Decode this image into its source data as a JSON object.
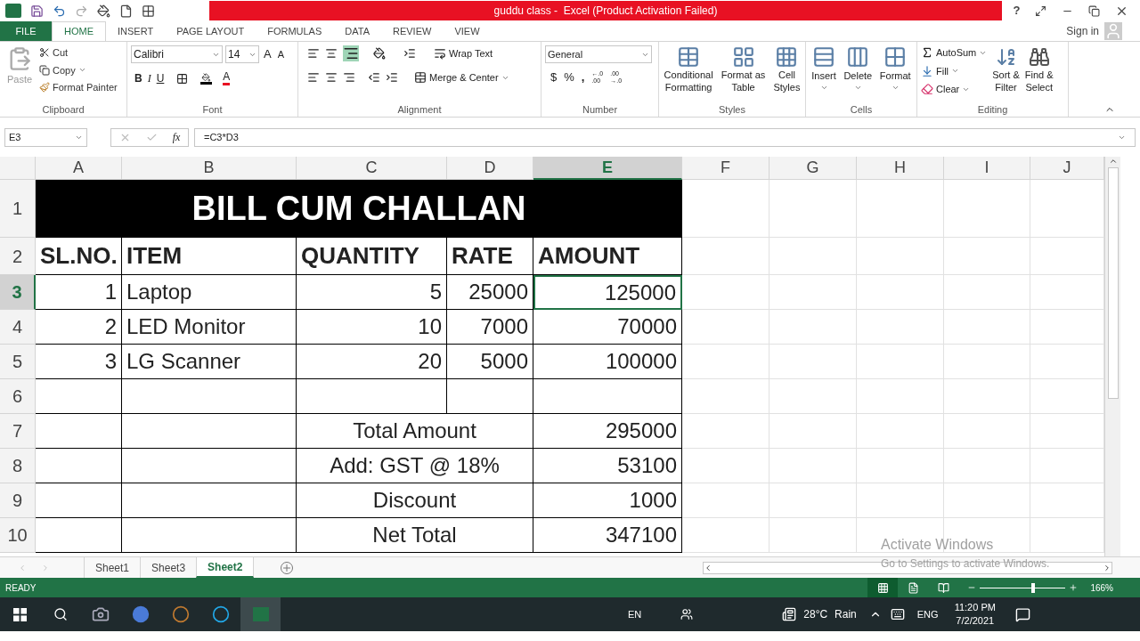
{
  "window": {
    "title": "guddu class -  Excel (Product Activation Failed)",
    "help": "?"
  },
  "ribbon_tabs": [
    {
      "label": "FILE",
      "kind": "file",
      "selected": false
    },
    {
      "label": "HOME",
      "kind": "tab",
      "selected": true
    },
    {
      "label": "INSERT",
      "kind": "tab",
      "selected": false
    },
    {
      "label": "PAGE LAYOUT",
      "kind": "tab",
      "selected": false
    },
    {
      "label": "FORMULAS",
      "kind": "tab",
      "selected": false
    },
    {
      "label": "DATA",
      "kind": "tab",
      "selected": false
    },
    {
      "label": "REVIEW",
      "kind": "tab",
      "selected": false
    },
    {
      "label": "VIEW",
      "kind": "tab",
      "selected": false
    }
  ],
  "sign_in": "Sign in",
  "clipboard": {
    "label": "Clipboard",
    "paste": "Paste",
    "cut": "Cut",
    "copy": "Copy",
    "format_painter": "Format Painter"
  },
  "font": {
    "label": "Font",
    "name": "Calibri",
    "size": "14",
    "grow": "A",
    "shrink": "A",
    "bold": "B",
    "italic": "I",
    "underline": "U",
    "color_button": "A"
  },
  "alignment": {
    "label": "Alignment",
    "wrap": "Wrap Text",
    "merge": "Merge & Center"
  },
  "number": {
    "label": "Number",
    "format": "General",
    "currency": "$",
    "percent": "%",
    "comma": ",",
    "increase_decimal": [
      "←.0",
      ".00"
    ],
    "decrease_decimal": [
      ".00",
      "→.0"
    ]
  },
  "styles": {
    "label": "Styles",
    "items": [
      {
        "lines": [
          "Conditional",
          "Formatting"
        ]
      },
      {
        "lines": [
          "Format as",
          "Table"
        ]
      },
      {
        "lines": [
          "Cell",
          "Styles"
        ]
      }
    ]
  },
  "cells": {
    "label": "Cells",
    "items": [
      "Insert",
      "Delete",
      "Format"
    ]
  },
  "editing": {
    "label": "Editing",
    "autosum": "AutoSum",
    "fill": "Fill",
    "clear": "Clear",
    "sort": [
      "Sort &",
      "Filter"
    ],
    "find": [
      "Find &",
      "Select"
    ]
  },
  "formula_bar": {
    "name_box": "E3",
    "fx": "fx",
    "formula": "=C3*D3"
  },
  "columns": [
    {
      "label": "A",
      "selected": false
    },
    {
      "label": "B",
      "selected": false
    },
    {
      "label": "C",
      "selected": false
    },
    {
      "label": "D",
      "selected": false
    },
    {
      "label": "E",
      "selected": true
    },
    {
      "label": "F",
      "selected": false
    },
    {
      "label": "G",
      "selected": false
    },
    {
      "label": "H",
      "selected": false
    },
    {
      "label": "I",
      "selected": false
    },
    {
      "label": "J",
      "selected": false
    }
  ],
  "rows": [
    {
      "label": "1",
      "selected": false
    },
    {
      "label": "2",
      "selected": false
    },
    {
      "label": "3",
      "selected": true
    },
    {
      "label": "4",
      "selected": false
    },
    {
      "label": "5",
      "selected": false
    },
    {
      "label": "6",
      "selected": false
    },
    {
      "label": "7",
      "selected": false
    },
    {
      "label": "8",
      "selected": false
    },
    {
      "label": "9",
      "selected": false
    },
    {
      "label": "10",
      "selected": false
    }
  ],
  "sheet": {
    "title": "BILL CUM CHALLAN",
    "headers": [
      "SL.NO.",
      "ITEM",
      "QUANTITY",
      "RATE",
      "AMOUNT"
    ],
    "items": [
      {
        "cells": [
          {
            "text": "1",
            "selected": false
          },
          {
            "text": "Laptop",
            "selected": false
          },
          {
            "text": "5",
            "selected": false
          },
          {
            "text": "25000",
            "selected": false
          },
          {
            "text": "125000",
            "selected": true
          }
        ]
      },
      {
        "cells": [
          {
            "text": "2",
            "selected": false
          },
          {
            "text": "LED Monitor",
            "selected": false
          },
          {
            "text": "10",
            "selected": false
          },
          {
            "text": "7000",
            "selected": false
          },
          {
            "text": "70000",
            "selected": false
          }
        ]
      },
      {
        "cells": [
          {
            "text": "3",
            "selected": false
          },
          {
            "text": "LG Scanner",
            "selected": false
          },
          {
            "text": "20",
            "selected": false
          },
          {
            "text": "5000",
            "selected": false
          },
          {
            "text": "100000",
            "selected": false
          }
        ]
      }
    ],
    "summary": [
      {
        "label": "Total Amount",
        "value": "295000"
      },
      {
        "label": "Add: GST @ 18%",
        "value": "53100"
      },
      {
        "label": "Discount",
        "value": "1000"
      },
      {
        "label": "Net Total",
        "value": "347100"
      }
    ]
  },
  "sheet_tabs": [
    {
      "label": "Sheet1",
      "selected": false
    },
    {
      "label": "Sheet3",
      "selected": false
    },
    {
      "label": "Sheet2",
      "selected": true
    }
  ],
  "status_bar": {
    "status": "READY",
    "views": [
      {
        "selected": true
      },
      {
        "selected": false
      },
      {
        "selected": false
      }
    ],
    "zoom": {
      "level": 0.63,
      "reading": "166%"
    }
  },
  "activation": {
    "title": "Activate Windows",
    "subtitle": "Go to Settings to activate Windows."
  },
  "taskbar": {
    "apps": [
      {
        "selected": false
      },
      {
        "selected": false
      },
      {
        "selected": false
      },
      {
        "selected": false
      },
      {
        "selected": false
      },
      {
        "selected": false
      },
      {
        "selected": true
      }
    ],
    "lang": "EN",
    "temperature": "28°C",
    "weather": "Rain",
    "input": "ENG",
    "time": "11:20 PM",
    "date": "7/2/2021"
  }
}
